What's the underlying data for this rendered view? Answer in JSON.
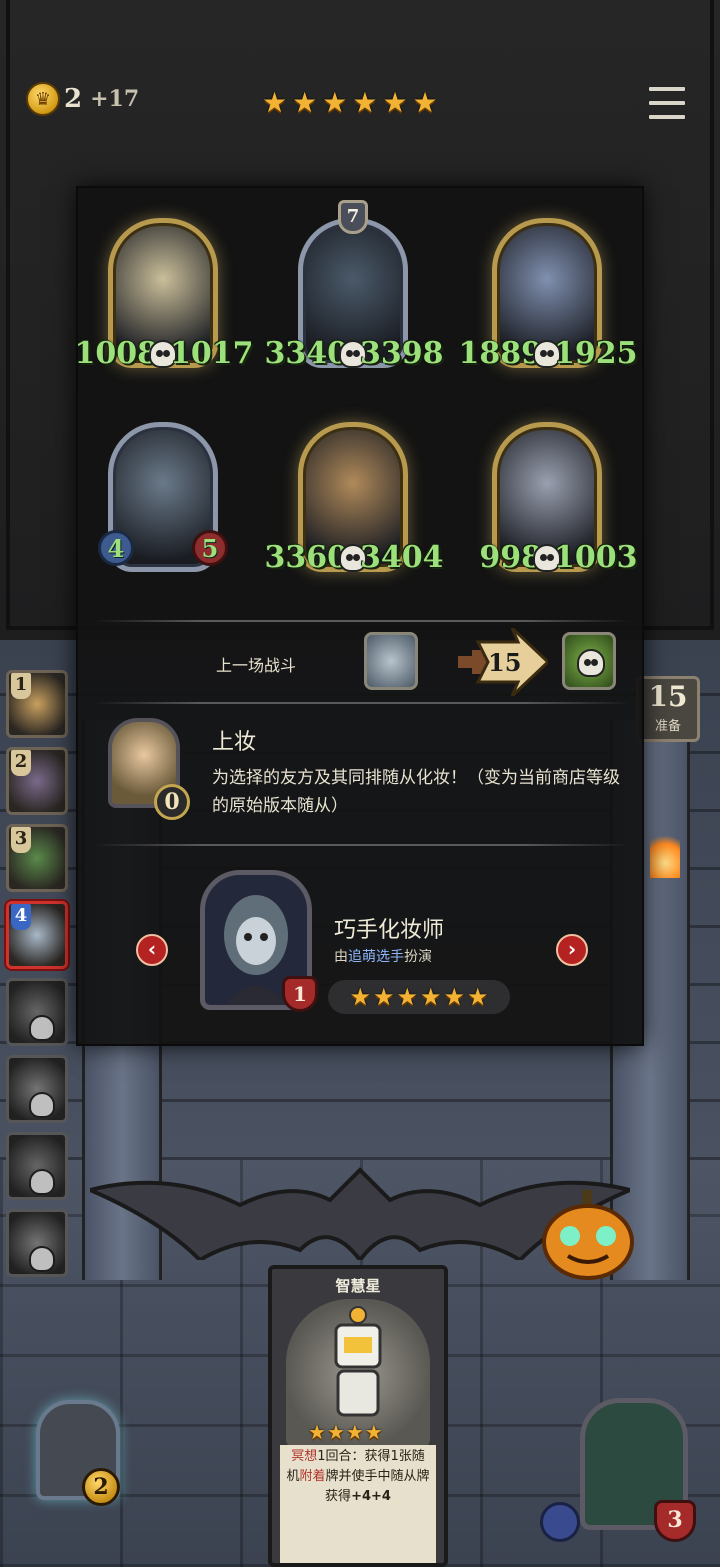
{
  "top_bar": {
    "coins": "2",
    "coin_income": "+17",
    "tavern_stars": 6
  },
  "lineup": {
    "minions": [
      {
        "id": "m1",
        "attack": "1008",
        "health": "1017",
        "golden": true,
        "tier": null,
        "dead": true
      },
      {
        "id": "m2",
        "attack": "3340",
        "health": "3398",
        "golden": false,
        "tier": "7",
        "dead": true
      },
      {
        "id": "m3",
        "attack": "1889",
        "health": "1925",
        "golden": true,
        "tier": null,
        "dead": true
      },
      {
        "id": "m4",
        "attack": "4",
        "health": "5",
        "golden": false,
        "tier": null,
        "dead": false
      },
      {
        "id": "m5",
        "attack": "3360",
        "health": "3404",
        "golden": true,
        "tier": null,
        "dead": true
      },
      {
        "id": "m6",
        "attack": "998",
        "health": "1003",
        "golden": true,
        "tier": null,
        "dead": true
      }
    ]
  },
  "last_battle": {
    "label": "上一场战斗",
    "damage": "15"
  },
  "hero_power_detail": {
    "title": "上妆",
    "cost": "0",
    "description": "为选择的友方及其同排随从化妆！（变为当前商店等级的原始版本随从）"
  },
  "hero_info": {
    "name": "巧手化妆师",
    "played_by_prefix": "由",
    "player": "追萌选手",
    "played_by_suffix": "扮演",
    "health": "1",
    "stars": 6
  },
  "sidebar": {
    "slots": [
      {
        "rank": "1",
        "state": "alive"
      },
      {
        "rank": "2",
        "state": "alive"
      },
      {
        "rank": "3",
        "state": "alive"
      },
      {
        "rank": "4",
        "state": "active"
      },
      {
        "rank": "",
        "state": "dead"
      },
      {
        "rank": "",
        "state": "dead"
      },
      {
        "rank": "",
        "state": "dead"
      },
      {
        "rank": "",
        "state": "dead"
      }
    ]
  },
  "timer": {
    "value": "15",
    "label": "准备"
  },
  "bottom_card": {
    "title": "智慧星",
    "stars": 4,
    "text_kw1": "冥想",
    "text_1": "1回合：获得1张随机",
    "text_kw2": "附着",
    "text_2": "牌并使手中随从牌获得",
    "text_bold": "+4+4"
  },
  "hero_power_button": {
    "cost": "2"
  },
  "player_hero": {
    "health": "3"
  },
  "colors": {
    "gold_star": "#f2b233",
    "stat_green": "#9be07a",
    "active_red": "#d0322d"
  }
}
